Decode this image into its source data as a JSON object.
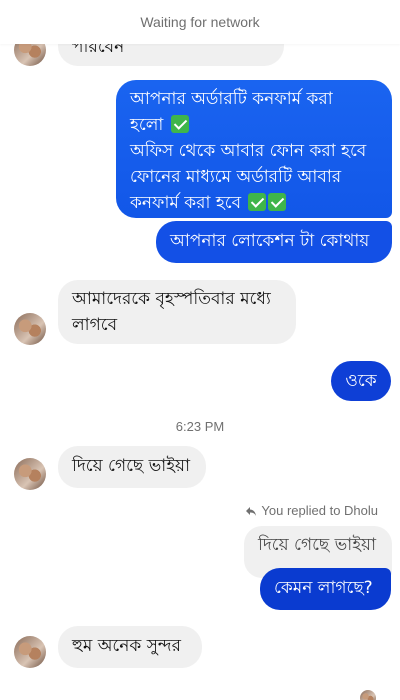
{
  "header": {
    "status": "Waiting for network"
  },
  "colors": {
    "outgoing_top": "#1a64f0",
    "outgoing_bottom": "#0a3fd6",
    "incoming": "#f0f0f0",
    "check_emoji": "#3fb54a"
  },
  "messages": {
    "m0": {
      "text": "পারবেন"
    },
    "m1": {
      "line1": "আপনার অর্ডারটি কনফার্ম করা",
      "line2": "হলো",
      "line3": "অফিস থেকে আবার ফোন করা হবে",
      "line4": "ফোনের মাধ্যমে অর্ডারটি আবার",
      "line5": "কনফার্ম করা হবে"
    },
    "m2": {
      "text": "আপনার লোকেশন টা কোথায়"
    },
    "m3": {
      "line1": "আমাদেরকে বৃহস্পতিবার মধ্যে",
      "line2": "লাগবে"
    },
    "m4": {
      "text": "ওকে"
    },
    "time": "6:23 PM",
    "m5": {
      "text": "দিয়ে গেছে ভাইয়া"
    },
    "reply": {
      "label": "You replied to Dholu",
      "quoted": "দিয়ে গেছে ভাইয়া"
    },
    "m6": {
      "text": "কেমন লাগছে?"
    },
    "m7": {
      "text": "হুম অনেক সুন্দর"
    }
  }
}
